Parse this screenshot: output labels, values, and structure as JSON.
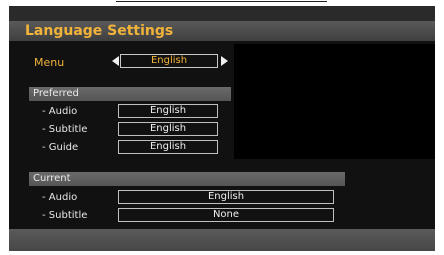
{
  "window": {
    "title": "Language Settings"
  },
  "menu": {
    "label": "Menu",
    "value": "English"
  },
  "preferred": {
    "header": "Preferred",
    "rows": [
      {
        "label": "- Audio",
        "value": "English"
      },
      {
        "label": "- Subtitle",
        "value": "English"
      },
      {
        "label": "- Guide",
        "value": "English"
      }
    ]
  },
  "current": {
    "header": "Current",
    "rows": [
      {
        "label": "- Audio",
        "value": "English"
      },
      {
        "label": "- Subtitle",
        "value": "None"
      }
    ]
  },
  "colors": {
    "accent": "#f2b33a",
    "panel": "#111111",
    "bar": "#4f4f4f"
  }
}
